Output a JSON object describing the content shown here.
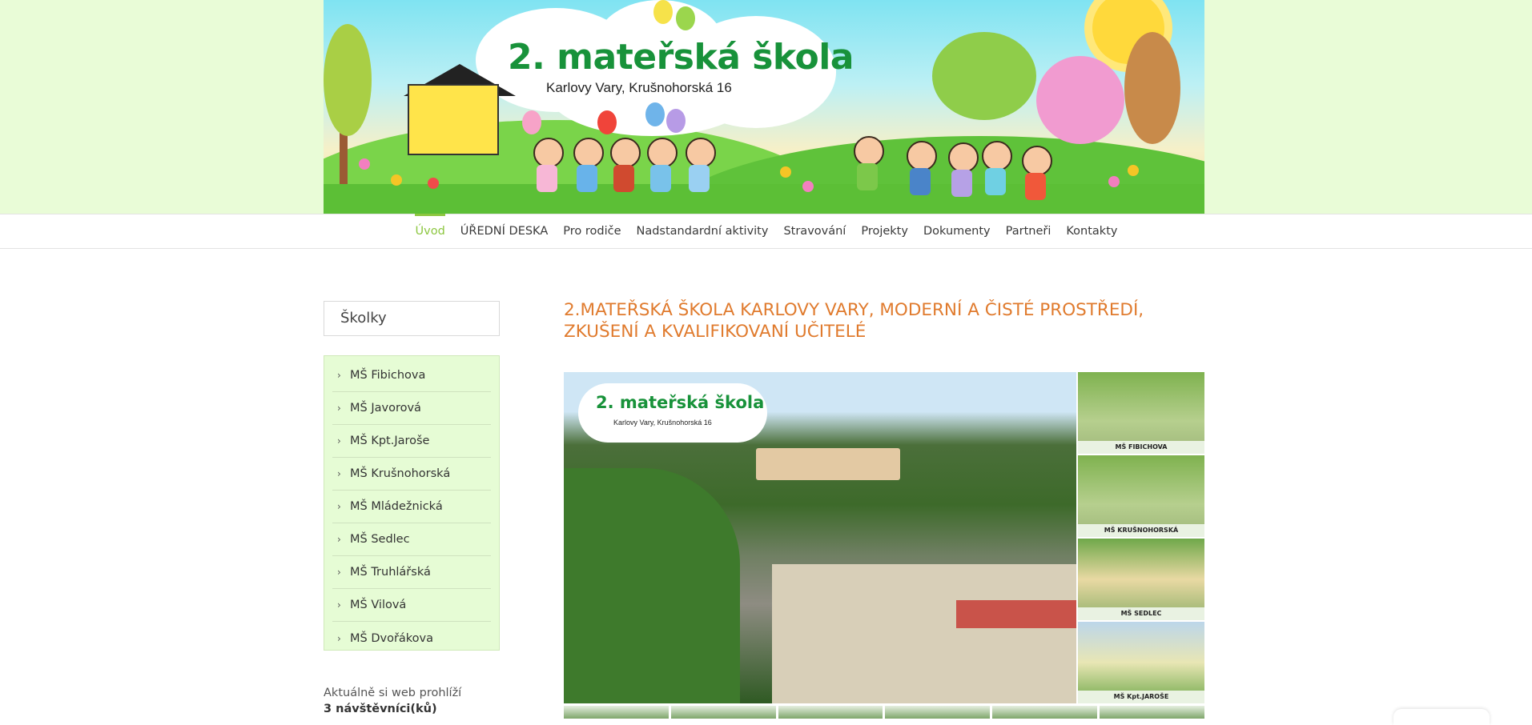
{
  "header": {
    "title": "2. mateřská škola",
    "subtitle": "Karlovy Vary, Krušnohorská 16"
  },
  "nav": {
    "items": [
      {
        "label": "Úvod",
        "active": true
      },
      {
        "label": "ÚŘEDNÍ DESKA",
        "active": false
      },
      {
        "label": "Pro rodiče",
        "active": false
      },
      {
        "label": "Nadstandardní aktivity",
        "active": false
      },
      {
        "label": "Stravování",
        "active": false
      },
      {
        "label": "Projekty",
        "active": false
      },
      {
        "label": "Dokumenty",
        "active": false
      },
      {
        "label": "Partneři",
        "active": false
      },
      {
        "label": "Kontakty",
        "active": false
      }
    ]
  },
  "sidebar": {
    "title": "Školky",
    "items": [
      "MŠ Fibichova",
      "MŠ Javorová",
      "MŠ Kpt.Jaroše",
      "MŠ Krušnohorská",
      "MŠ Mládežnická",
      "MŠ Sedlec",
      "MŠ Truhlářská",
      "MŠ Vilová",
      "MŠ Dvořákova"
    ],
    "visitors_label": "Aktuálně si web prohlíží",
    "visitors_count": "3 návštěvníci(ků)"
  },
  "main": {
    "heading": "2.MATEŘSKÁ ŠKOLA KARLOVY VARY, MODERNÍ A ČISTÉ PROSTŘEDÍ, ZKUŠENÍ A KVALIFIKOVANÍ UČITELÉ",
    "photo": {
      "overlay_title": "2. mateřská škola",
      "overlay_subtitle": "Karlovy Vary, Krušnohorská 16"
    },
    "thumbs": [
      "MŠ FIBICHOVA",
      "MŠ KRUŠNOHORSKÁ",
      "MŠ SEDLEC",
      "MŠ Kpt.JAROŠE"
    ]
  },
  "colors": {
    "accent_green": "#8cc63f",
    "heading_orange": "#e07b2e",
    "logo_green": "#18923a",
    "sidebar_bg": "#e6fcd5",
    "top_band": "#e9fcd7"
  }
}
